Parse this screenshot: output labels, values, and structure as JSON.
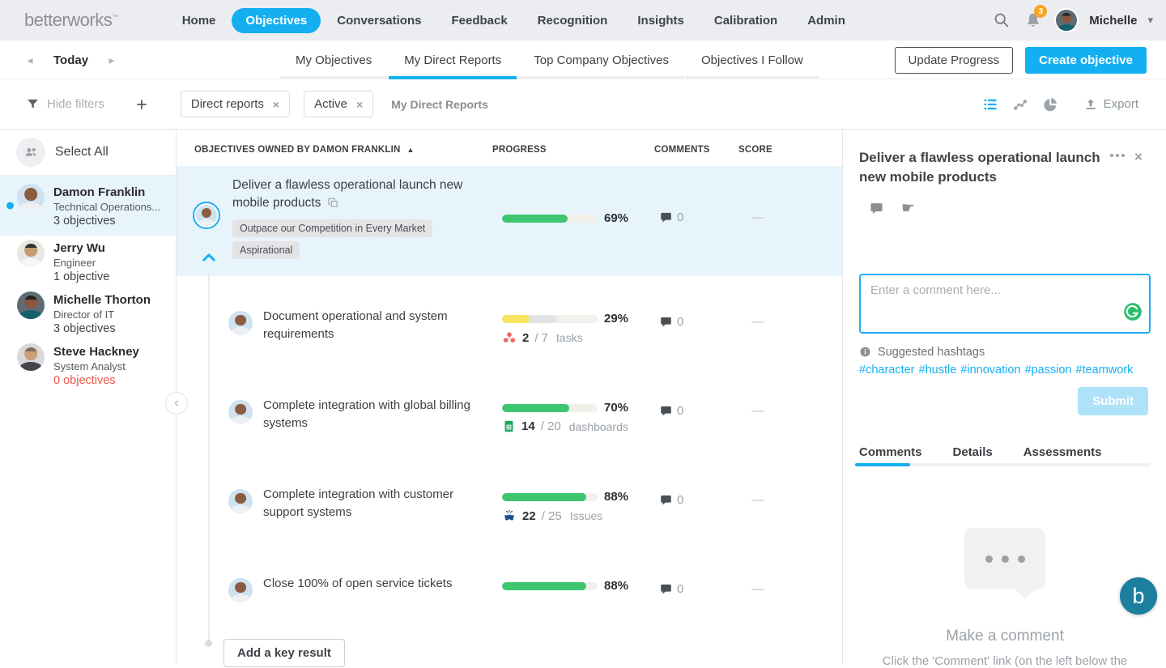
{
  "topnav": {
    "logo": "betterworks",
    "items": [
      "Home",
      "Objectives",
      "Conversations",
      "Feedback",
      "Recognition",
      "Insights",
      "Calibration",
      "Admin"
    ],
    "active_item": "Objectives",
    "notification_count": "3",
    "user_name": "Michelle"
  },
  "toolbar": {
    "date_label": "Today",
    "tabs": [
      "My Objectives",
      "My Direct Reports",
      "Top Company Objectives",
      "Objectives I Follow"
    ],
    "active_tab": "My Direct Reports",
    "update_progress_label": "Update Progress",
    "create_objective_label": "Create objective"
  },
  "filterbar": {
    "hide_filters_label": "Hide filters",
    "chips": [
      "Direct reports",
      "Active"
    ],
    "context_label": "My Direct Reports",
    "export_label": "Export"
  },
  "sidebar": {
    "select_all_label": "Select All",
    "people": [
      {
        "name": "Damon Franklin",
        "title": "Technical Operations...",
        "count": "3 objectives",
        "selected": true
      },
      {
        "name": "Jerry Wu",
        "title": "Engineer",
        "count": "1 objective",
        "selected": false
      },
      {
        "name": "Michelle Thorton",
        "title": "Director of IT",
        "count": "3 objectives",
        "selected": false
      },
      {
        "name": "Steve Hackney",
        "title": "System Analyst",
        "count": "0 objectives",
        "selected": false
      }
    ]
  },
  "table": {
    "section_header": "Objectives owned by Damon Franklin",
    "col_progress": "Progress",
    "col_comments": "Comments",
    "col_score": "Score",
    "objective": {
      "title": "Deliver a flawless operational launch new mobile products",
      "tags": [
        "Outpace our Competition in Every Market",
        "Aspirational"
      ],
      "progress_pct": 69,
      "progress_label": "69%",
      "comment_count": "0",
      "score": "—"
    },
    "key_results": [
      {
        "title": "Document operational and system requirements",
        "progress_pct": 29,
        "expected_pct": 58,
        "progress_label": "29%",
        "integration": "asana",
        "done": "2",
        "total_label": "/ 7",
        "unit": "tasks",
        "comment_count": "0",
        "score": "—"
      },
      {
        "title": "Complete integration with global billing systems",
        "progress_pct": 70,
        "progress_label": "70%",
        "integration": "google-sheets",
        "done": "14",
        "total_label": "/ 20",
        "unit": "dashboards",
        "comment_count": "0",
        "score": "—"
      },
      {
        "title": "Complete integration with customer support systems",
        "progress_pct": 88,
        "progress_label": "88%",
        "integration": "jira",
        "done": "22",
        "total_label": "/ 25",
        "unit": "Issues",
        "comment_count": "0",
        "score": "—"
      },
      {
        "title": "Close 100% of open service tickets",
        "progress_pct": 88,
        "progress_label": "88%",
        "comment_count": "0",
        "score": "—"
      }
    ],
    "add_key_result_label": "Add a key result"
  },
  "detail_panel": {
    "title": "Deliver a flawless operational launch new mobile products",
    "comment_placeholder": "Enter a comment here...",
    "suggested_hashtags_label": "Suggested hashtags",
    "hashtags": [
      "#character",
      "#hustle",
      "#innovation",
      "#passion",
      "#teamwork"
    ],
    "submit_label": "Submit",
    "tabs": [
      "Comments",
      "Details",
      "Assessments"
    ],
    "active_tab": "Comments",
    "empty_state_title": "Make a comment",
    "empty_state_subtitle": "Click the 'Comment' link (on the left below the"
  },
  "colors": {
    "accent_blue": "#14AFF1",
    "progress_green": "#3EC66F",
    "progress_yellow": "#F6E35F",
    "badge_orange": "#F5A623",
    "alert_red": "#F0564A",
    "selected_row_blue": "#E8F4FC",
    "grammarly_green": "#2ABF6F",
    "chat_widget_teal": "#1B7F9D"
  }
}
